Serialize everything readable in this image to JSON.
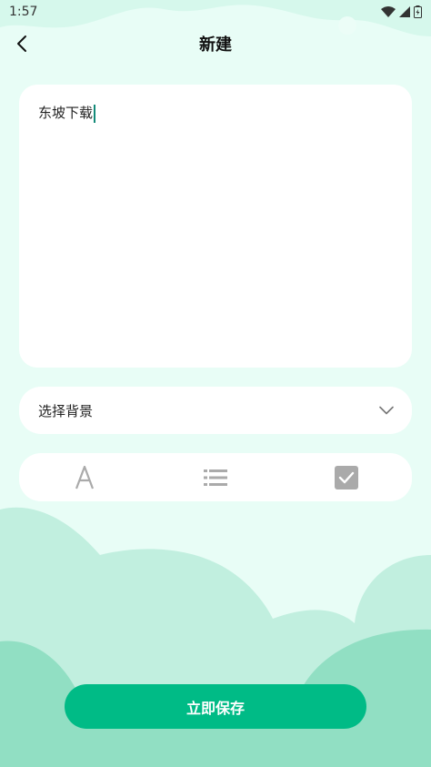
{
  "status_bar": {
    "time": "1:57",
    "icons": [
      "wifi-icon",
      "signal-icon",
      "battery-icon"
    ]
  },
  "header": {
    "title": "新建",
    "back_icon": "chevron-left-icon"
  },
  "editor": {
    "text": "东坡下载"
  },
  "background_select": {
    "label": "选择背景",
    "icon": "chevron-down-icon"
  },
  "toolbar": {
    "tools": [
      "text-format-icon",
      "list-icon",
      "checkbox-icon"
    ]
  },
  "save_button": {
    "label": "立即保存"
  },
  "colors": {
    "accent": "#00bb86",
    "background": "#e8fdf6",
    "hill_light": "#c1efdf",
    "hill_dark": "#91dfc3",
    "caret": "#138a78"
  }
}
